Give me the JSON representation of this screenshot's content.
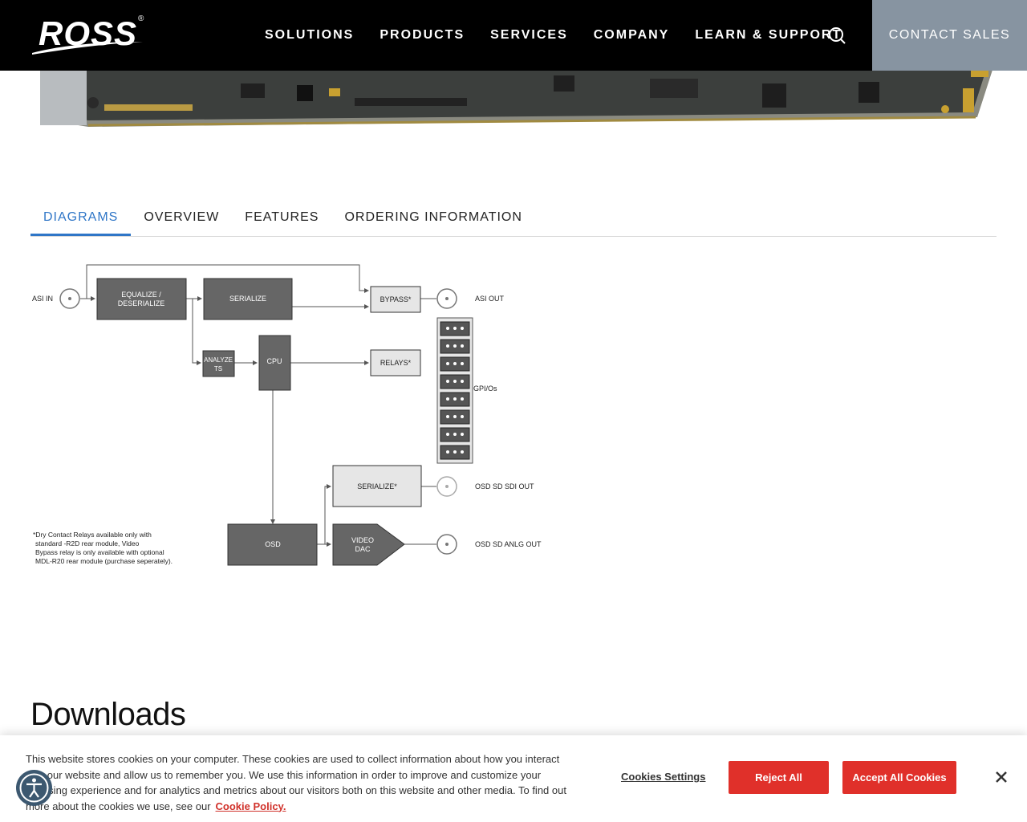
{
  "header": {
    "logo_text": "ROSS",
    "logo_mark": "®",
    "nav": [
      "SOLUTIONS",
      "PRODUCTS",
      "SERVICES",
      "COMPANY",
      "LEARN & SUPPORT"
    ],
    "contact_label": "CONTACT SALES",
    "search_icon": "search-icon"
  },
  "tabs": [
    "DIAGRAMS",
    "OVERVIEW",
    "FEATURES",
    "ORDERING INFORMATION"
  ],
  "active_tab": "DIAGRAMS",
  "diagram": {
    "asi_in": "ASI IN",
    "equalize_1": "EQUALIZE /",
    "equalize_2": "DESERIALIZE",
    "serialize": "SERIALIZE",
    "bypass": "BYPASS*",
    "asi_out": "ASI OUT",
    "analyze_1": "ANALYZE",
    "analyze_2": "TS",
    "cpu": "CPU",
    "relays": "RELAYS*",
    "gpios": "GPI/Os",
    "serialize2": "SERIALIZE*",
    "osd_sdi_out": "OSD SD SDI OUT",
    "osd": "OSD",
    "video_dac_1": "VIDEO",
    "video_dac_2": "DAC",
    "osd_anlg_out": "OSD SD ANLG OUT",
    "note_1": "*Dry Contact Relays available only with",
    "note_2": "standard -R2D rear module, Video",
    "note_3": "Bypass relay is only available with optional",
    "note_4": "MDL-R20 rear module (purchase seperately)."
  },
  "downloads_heading": "Downloads",
  "cookie": {
    "text": "This website stores cookies on your computer. These cookies are used to collect information about how you interact with our website and allow us to remember you. We use this information in order to improve and customize your browsing experience and for analytics and metrics about our visitors both on this website and other media. To find out more about the cookies we use, see our",
    "policy_link": "Cookie Policy.",
    "settings_label": "Cookies Settings",
    "reject_label": "Reject All",
    "accept_label": "Accept All Cookies"
  },
  "colors": {
    "accent": "#2f76c7",
    "cookie_button": "#e0302a",
    "contact_bg": "#8794a1"
  }
}
